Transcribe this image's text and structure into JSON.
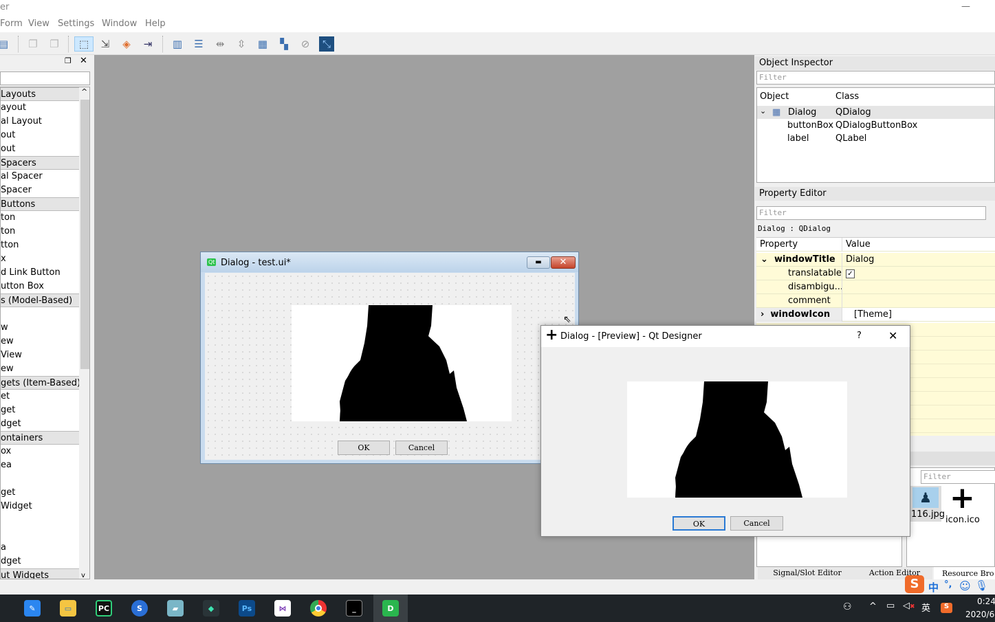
{
  "app": {
    "title_fragment": "er"
  },
  "menu": [
    "Form",
    "View",
    "Settings",
    "Window",
    "Help"
  ],
  "toolbar_icons": [
    "save-icon",
    "bring-to-front-icon",
    "send-to-back-icon",
    "edit-widgets-icon",
    "edit-signals-slots-icon",
    "edit-buddies-icon",
    "edit-tab-order-icon",
    "layout-horizontal-icon",
    "layout-vertical-icon",
    "splitter-horizontal-icon",
    "splitter-vertical-icon",
    "layout-grid-icon",
    "layout-form-icon",
    "break-layout-icon",
    "adjust-size-icon"
  ],
  "widget_box": {
    "items": [
      {
        "label": "Layouts",
        "category": true
      },
      {
        "label": "ayout"
      },
      {
        "label": "al Layout"
      },
      {
        "label": "out"
      },
      {
        "label": "out"
      },
      {
        "label": "Spacers",
        "category": true
      },
      {
        "label": "al Spacer"
      },
      {
        "label": "Spacer"
      },
      {
        "label": "Buttons",
        "category": true
      },
      {
        "label": "ton"
      },
      {
        "label": "ton"
      },
      {
        "label": "tton"
      },
      {
        "label": "x"
      },
      {
        "label": "d Link Button"
      },
      {
        "label": "utton Box"
      },
      {
        "label": "s (Model-Based)",
        "category": true
      },
      {
        "label": ""
      },
      {
        "label": "w"
      },
      {
        "label": "ew"
      },
      {
        "label": "View"
      },
      {
        "label": "ew"
      },
      {
        "label": "gets (Item-Based)",
        "category": true
      },
      {
        "label": "et"
      },
      {
        "label": "get"
      },
      {
        "label": "dget"
      },
      {
        "label": "ontainers",
        "category": true
      },
      {
        "label": "ox"
      },
      {
        "label": "ea"
      },
      {
        "label": ""
      },
      {
        "label": "get"
      },
      {
        "label": "Widget"
      },
      {
        "label": ""
      },
      {
        "label": ""
      },
      {
        "label": "a"
      },
      {
        "label": "dget"
      },
      {
        "label": "ut Widgets",
        "category": true
      }
    ]
  },
  "object_inspector": {
    "title": "Object Inspector",
    "filter_placeholder": "Filter",
    "col_object": "Object",
    "col_class": "Class",
    "rows": [
      {
        "object": "Dialog",
        "class": "QDialog"
      },
      {
        "object": "buttonBox",
        "class": "QDialogButtonBox"
      },
      {
        "object": "label",
        "class": "QLabel"
      }
    ]
  },
  "property_editor": {
    "title": "Property Editor",
    "filter_placeholder": "Filter",
    "context": "Dialog : QDialog",
    "col_property": "Property",
    "col_value": "Value",
    "rows": [
      {
        "property": "windowTitle",
        "value": "Dialog",
        "bold": true,
        "expanded": true
      },
      {
        "property": "translatable",
        "value": "checked"
      },
      {
        "property": "disambigu...",
        "value": ""
      },
      {
        "property": "comment",
        "value": ""
      },
      {
        "property": "windowIcon",
        "value": "[Theme]",
        "bold": true,
        "expanded": false
      }
    ]
  },
  "resource_browser": {
    "filter_placeholder": "Filter",
    "files": [
      "116.jpg",
      "icon.ico"
    ]
  },
  "bottom_tabs": [
    "Signal/Slot Editor",
    "Action Editor",
    "Resource Bro"
  ],
  "form_window": {
    "title": "Dialog - test.ui*",
    "ok": "OK",
    "cancel": "Cancel",
    "badge": "Qt"
  },
  "preview_window": {
    "title": "Dialog - [Preview] - Qt Designer",
    "help": "?",
    "ok": "OK",
    "cancel": "Cancel"
  },
  "ime": {
    "lang": "中",
    "punct": "°,"
  },
  "tray": {
    "input_lang": "英",
    "time": "0:24",
    "date": "2020/6"
  },
  "taskbar_apps": [
    "feishu",
    "file-explorer",
    "pycharm",
    "sogou-browser",
    "notepad",
    "app",
    "photoshop",
    "visual-studio",
    "chrome",
    "terminal",
    "qt-designer"
  ],
  "colors": {
    "selection": "#cde8ff",
    "property_yellow": "#fffbd7",
    "taskbar": "#1f2428",
    "central": "#a0a0a0"
  }
}
